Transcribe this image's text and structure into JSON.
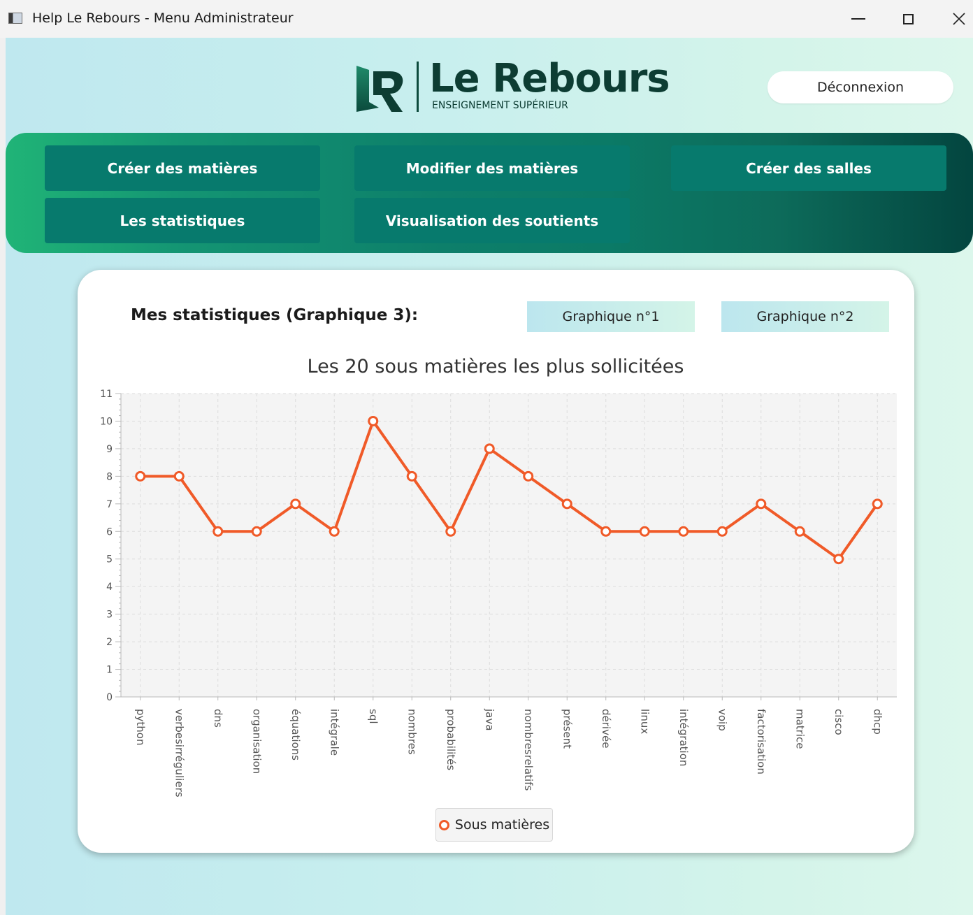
{
  "window": {
    "title": "Help Le Rebours - Menu Administrateur",
    "icon": "app-window-icon"
  },
  "header": {
    "logo_name": "Le Rebours",
    "logo_subtitle": "ENSEIGNEMENT SUPÉRIEUR",
    "logout_label": "Déconnexion"
  },
  "nav": {
    "create_subjects": "Créer des matières",
    "edit_subjects": "Modifier des matières",
    "create_rooms": "Créer des salles",
    "statistics": "Les statistiques",
    "view_supports": "Visualisation des soutients"
  },
  "stats": {
    "title": "Mes statistiques (Graphique 3):",
    "graph1_label": "Graphique n°1",
    "graph2_label": "Graphique n°2"
  },
  "colors": {
    "accent": "#f05a28",
    "nav_button": "#077a6d",
    "brand_dark": "#0d3d33"
  },
  "chart_data": {
    "type": "line",
    "title": "Les 20 sous matières les plus sollicitées",
    "xlabel": "",
    "ylabel": "",
    "ylim": [
      0,
      11
    ],
    "yticks": [
      0,
      1,
      2,
      3,
      4,
      5,
      6,
      7,
      8,
      9,
      10,
      11
    ],
    "grid": true,
    "legend_position": "bottom",
    "categories": [
      "python",
      "verbesirréguliers",
      "dns",
      "organisation",
      "équations",
      "intégrale",
      "sql",
      "nombres",
      "probabilités",
      "java",
      "nombresrelatifs",
      "présent",
      "dérivée",
      "linux",
      "intégration",
      "voip",
      "factorisation",
      "matrice",
      "cisco",
      "dhcp"
    ],
    "series": [
      {
        "name": "Sous matières",
        "values": [
          8,
          8,
          6,
          6,
          7,
          6,
          10,
          8,
          6,
          9,
          8,
          7,
          6,
          6,
          6,
          6,
          7,
          6,
          5,
          7
        ]
      }
    ]
  }
}
